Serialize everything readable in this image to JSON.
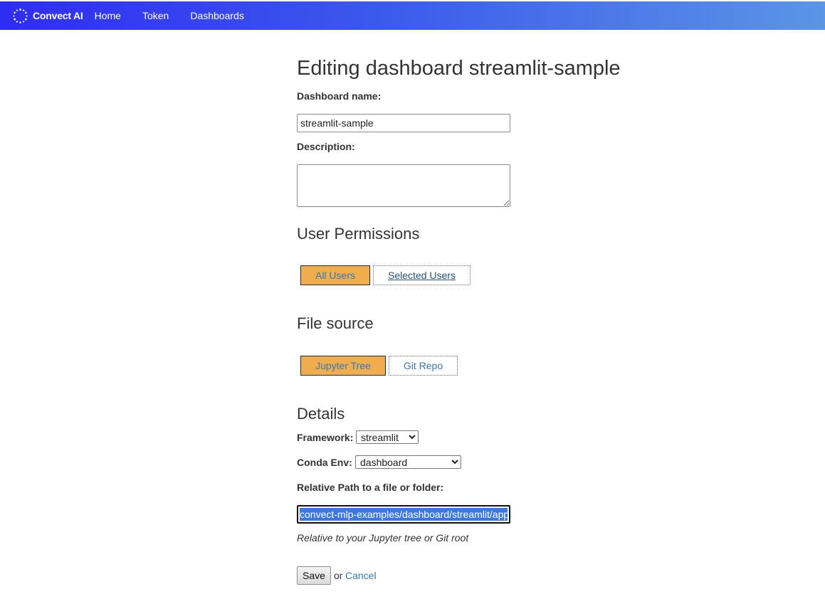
{
  "navbar": {
    "brand": "Convect AI",
    "brand_icon": "convect-logo-icon",
    "links": [
      "Home",
      "Token",
      "Dashboards"
    ]
  },
  "page": {
    "title": "Editing dashboard streamlit-sample"
  },
  "form": {
    "dashboard_name_label": "Dashboard name:",
    "dashboard_name_value": "streamlit-sample",
    "description_label": "Description:",
    "description_value": ""
  },
  "permissions": {
    "heading": "User Permissions",
    "options": [
      "All Users",
      "Selected Users"
    ],
    "selected": "All Users"
  },
  "file_source": {
    "heading": "File source",
    "options": [
      "Jupyter Tree",
      "Git Repo"
    ],
    "selected": "Jupyter Tree"
  },
  "details": {
    "heading": "Details",
    "framework_label": "Framework:",
    "framework_value": "streamlit",
    "conda_env_label": "Conda Env:",
    "conda_env_value": "dashboard",
    "relative_path_label": "Relative Path to a file or folder:",
    "relative_path_value": "convect-mlp-examples/dashboard/streamlit/app.py",
    "relative_path_hint": "Relative to your Jupyter tree or Git root"
  },
  "actions": {
    "save_label": "Save",
    "or_text": "or",
    "cancel_label": "Cancel"
  },
  "colors": {
    "navbar_gradient_start": "#2f2df0",
    "navbar_gradient_end": "#5b95e6",
    "active_tab": "#f0ad4e",
    "link": "#337ab7",
    "selection": "#3a79e0"
  }
}
